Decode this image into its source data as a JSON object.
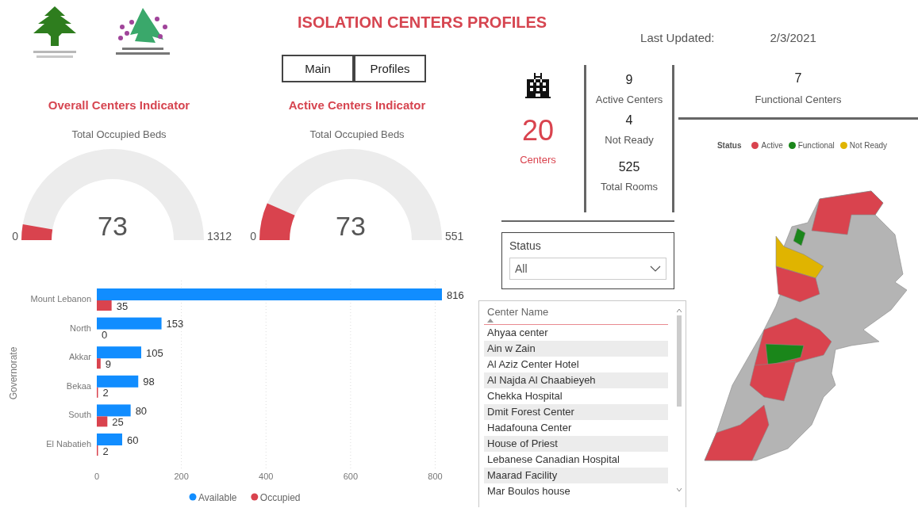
{
  "header": {
    "title": "ISOLATION CENTERS PROFILES",
    "last_updated_label": "Last Updated:",
    "last_updated_value": "2/3/2021"
  },
  "nav_buttons": [
    {
      "label": "Main"
    },
    {
      "label": "Profiles"
    }
  ],
  "gauges": [
    {
      "title": "Overall Centers Indicator",
      "subtitle": "Total Occupied Beds",
      "value": "73",
      "min": "0",
      "max": "1312",
      "level": 0.0556
    },
    {
      "title": "Active Centers Indicator",
      "subtitle": "Total Occupied Beds",
      "value": "73",
      "min": "0",
      "max": "551",
      "level": 0.1325
    }
  ],
  "bar_chart": {
    "chart_data": {
      "type": "bar",
      "orientation": "horizontal",
      "ylabel": "Governorate",
      "categories": [
        "Mount Lebanon",
        "North",
        "Akkar",
        "Bekaa",
        "South",
        "El Nabatieh"
      ],
      "series": [
        {
          "name": "Available",
          "color": "#118dff",
          "values": [
            816,
            153,
            105,
            98,
            80,
            60
          ]
        },
        {
          "name": "Occupied",
          "color": "#d9434e",
          "values": [
            35,
            0,
            9,
            2,
            25,
            2
          ]
        }
      ],
      "xlim": [
        0,
        816
      ],
      "xticks": [
        0,
        200,
        400,
        600,
        800
      ],
      "data_labels": true,
      "grid": true,
      "legend": true
    }
  },
  "kpis": {
    "total": {
      "value": "20",
      "label": "Centers"
    },
    "stats": [
      {
        "value": "9",
        "label": "Active Centers"
      },
      {
        "value": "4",
        "label": "Not Ready"
      },
      {
        "value": "525",
        "label": "Total Rooms"
      }
    ],
    "functional": {
      "value": "7",
      "label": "Functional Centers"
    }
  },
  "status_slicer": {
    "title": "Status",
    "value": "All"
  },
  "center_table": {
    "column": "Center Name",
    "rows": [
      "Ahyaa center",
      "Ain w Zain",
      "Al Aziz Center Hotel",
      "Al Najda Al Chaabieyeh",
      "Chekka Hospital",
      "Dmit Forest Center",
      "Hadafouna Center",
      "House of Priest",
      "Lebanese Canadian Hospital",
      "Maarad Facility",
      "Mar Boulos house"
    ]
  },
  "map": {
    "legend": {
      "title": "Status",
      "items": [
        {
          "label": "Active",
          "color": "#d9434e"
        },
        {
          "label": "Functional",
          "color": "#1a861a"
        },
        {
          "label": "Not Ready",
          "color": "#e0b400"
        }
      ]
    }
  }
}
